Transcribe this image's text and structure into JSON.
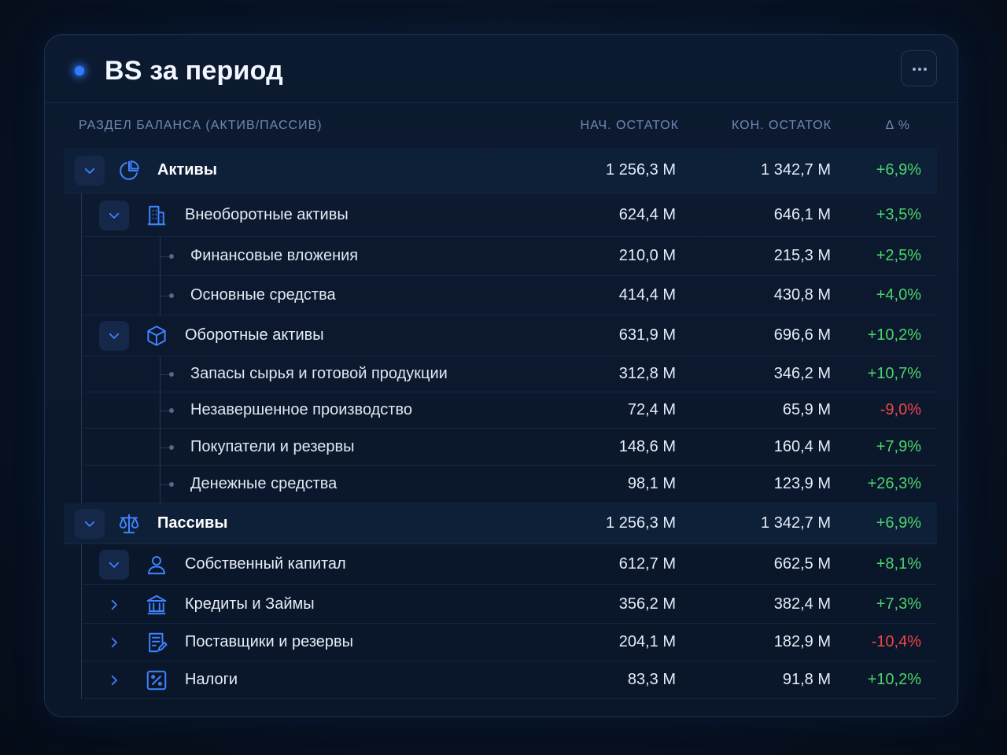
{
  "header": {
    "title": "BS за период",
    "menu_icon": "more-horizontal-icon"
  },
  "columns": {
    "section": "РАЗДЕЛ БАЛАНСА (АКТИВ/ПАССИВ)",
    "start": "НАЧ. ОСТАТОК",
    "end": "КОН. ОСТАТОК",
    "delta": "Δ %"
  },
  "colors": {
    "accent": "#2f7dff",
    "positive": "#4cd46a",
    "negative": "#f04545"
  },
  "rows": [
    {
      "level": 0,
      "label": "Активы",
      "start": "1 256,3 M",
      "end": "1 342,7 M",
      "delta": "+6,9%",
      "trend": "pos",
      "icon": "pie-chart-icon",
      "expanded": true
    },
    {
      "level": 1,
      "label": "Внеоборотные активы",
      "start": "624,4 M",
      "end": "646,1 M",
      "delta": "+3,5%",
      "trend": "pos",
      "icon": "building-icon",
      "expanded": true
    },
    {
      "level": 2,
      "label": "Финансовые вложения",
      "start": "210,0 M",
      "end": "215,3 M",
      "delta": "+2,5%",
      "trend": "pos"
    },
    {
      "level": 2,
      "label": "Основные средства",
      "start": "414,4 M",
      "end": "430,8 M",
      "delta": "+4,0%",
      "trend": "pos"
    },
    {
      "level": 1,
      "label": "Оборотные активы",
      "start": "631,9 M",
      "end": "696,6 M",
      "delta": "+10,2%",
      "trend": "pos",
      "icon": "box-icon",
      "expanded": true
    },
    {
      "level": 2,
      "label": "Запасы сырья и готовой продукции",
      "start": "312,8 M",
      "end": "346,2 M",
      "delta": "+10,7%",
      "trend": "pos"
    },
    {
      "level": 2,
      "label": "Незавершенное производство",
      "start": "72,4 M",
      "end": "65,9 M",
      "delta": "-9,0%",
      "trend": "neg"
    },
    {
      "level": 2,
      "label": "Покупатели и резервы",
      "start": "148,6 M",
      "end": "160,4 M",
      "delta": "+7,9%",
      "trend": "pos"
    },
    {
      "level": 2,
      "label": "Денежные средства",
      "start": "98,1 M",
      "end": "123,9 M",
      "delta": "+26,3%",
      "trend": "pos"
    },
    {
      "level": 0,
      "label": "Пассивы",
      "start": "1 256,3 M",
      "end": "1 342,7 M",
      "delta": "+6,9%",
      "trend": "pos",
      "icon": "scales-icon",
      "expanded": true
    },
    {
      "level": 1,
      "label": "Собственный капитал",
      "start": "612,7 M",
      "end": "662,5 M",
      "delta": "+8,1%",
      "trend": "pos",
      "icon": "user-icon",
      "expanded": true
    },
    {
      "level": 1,
      "label": "Кредиты и Займы",
      "start": "356,2 M",
      "end": "382,4 M",
      "delta": "+7,3%",
      "trend": "pos",
      "icon": "bank-icon",
      "expanded": false
    },
    {
      "level": 1,
      "label": "Поставщики и резервы",
      "start": "204,1 M",
      "end": "182,9 M",
      "delta": "-10,4%",
      "trend": "neg",
      "icon": "invoice-icon",
      "expanded": false
    },
    {
      "level": 1,
      "label": "Налоги",
      "start": "83,3 M",
      "end": "91,8 M",
      "delta": "+10,2%",
      "trend": "pos",
      "icon": "percent-icon",
      "expanded": false
    }
  ]
}
